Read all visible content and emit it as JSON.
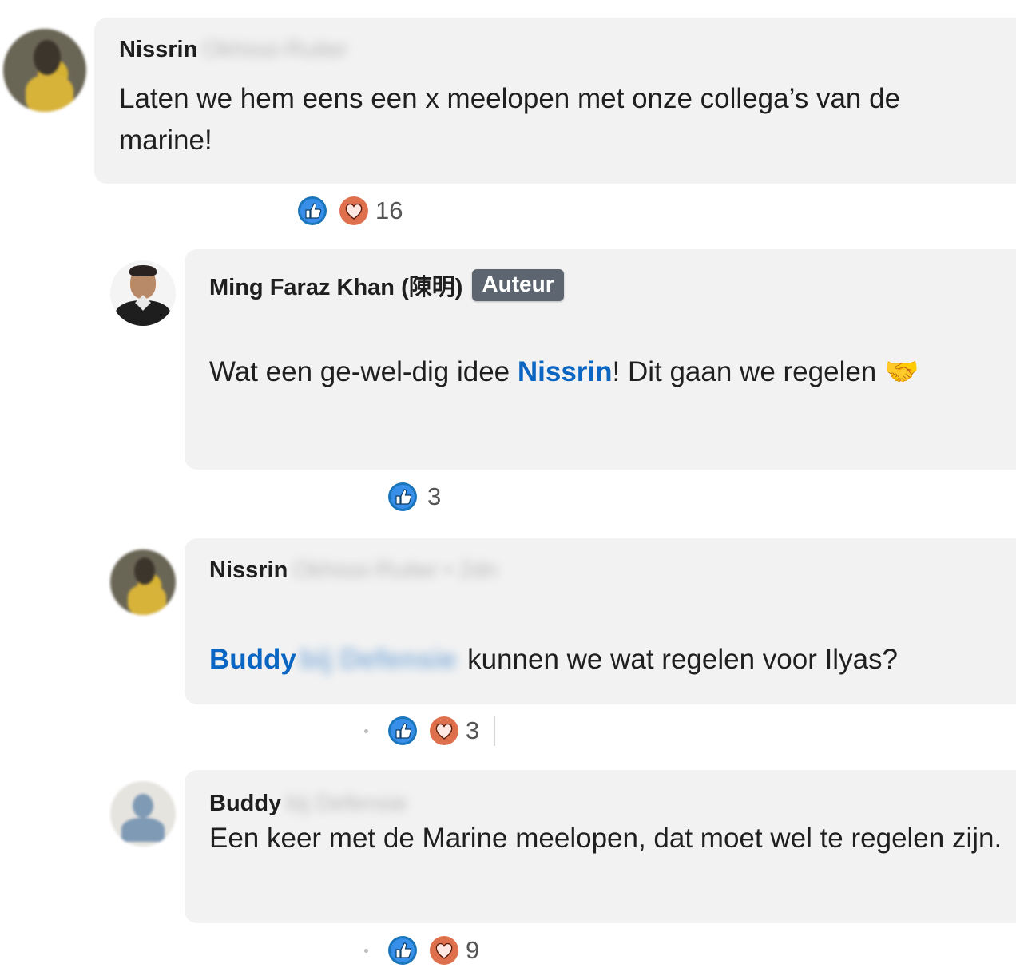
{
  "comments": [
    {
      "author": "Nissrin",
      "author_rest": "Okhissi-Ruiter",
      "message": "Laten we hem eens een x meelopen met onze collega’s van de marine!",
      "reaction_count": "16"
    },
    {
      "author": "Ming Faraz Khan (陳明)",
      "badge": "Auteur",
      "message_before": "Wat een ge-wel-dig idee ",
      "mention": "Nissrin",
      "message_after": "! Dit gaan we regelen 🤝",
      "reaction_count": "3"
    },
    {
      "author": "Nissrin",
      "author_rest": "Okhissi-Ruiter • 2dn",
      "mention": "Buddy",
      "mention_rest": "bij Defensie",
      "message_after": "kunnen we wat regelen voor Ilyas?",
      "reaction_count": "3"
    },
    {
      "author": "Buddy",
      "author_rest": "bij Defensie",
      "message": "Een keer met de Marine meelopen, dat moet wel te regelen zijn.",
      "reaction_count": "9"
    }
  ],
  "icons": {
    "like": "like-icon",
    "love": "love-icon"
  },
  "colors": {
    "bubble": "#f2f2f2",
    "mention": "#0a66c2",
    "like": "#1a75bb",
    "love": "#df704d",
    "badge": "#5d6670"
  }
}
